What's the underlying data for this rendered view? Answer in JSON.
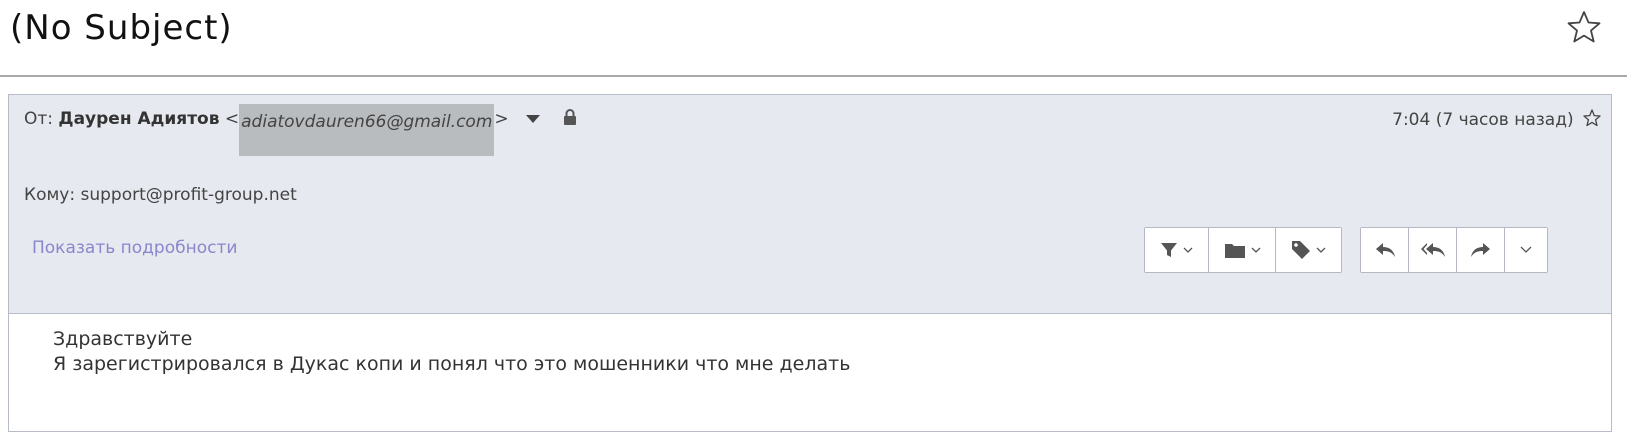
{
  "subject": "(No Subject)",
  "header": {
    "from_label": "От:",
    "from_name": "Даурен Адиятов",
    "from_email": "adiatovdauren66@gmail.com",
    "date": "7:04 (7 часов назад)",
    "to_label": "Кому:",
    "to_value": "support@profit-group.net",
    "details_link": "Показать подробности"
  },
  "body": {
    "lines": [
      "Здравствуйте",
      "Я зарегистрировался в Дукас копи и понял что это мошенники что мне делать"
    ]
  },
  "icons": {
    "top_star": "star-outline-icon",
    "lock": "lock-icon",
    "filter": "filter-icon",
    "folder": "folder-icon",
    "tag": "tag-icon",
    "reply": "reply-icon",
    "reply_all": "reply-all-icon",
    "forward": "forward-icon",
    "more": "chevron-down-icon"
  },
  "colors": {
    "header_bg": "#e6e9f0",
    "link": "#8a86cc",
    "highlight": "#b9bcbf"
  }
}
